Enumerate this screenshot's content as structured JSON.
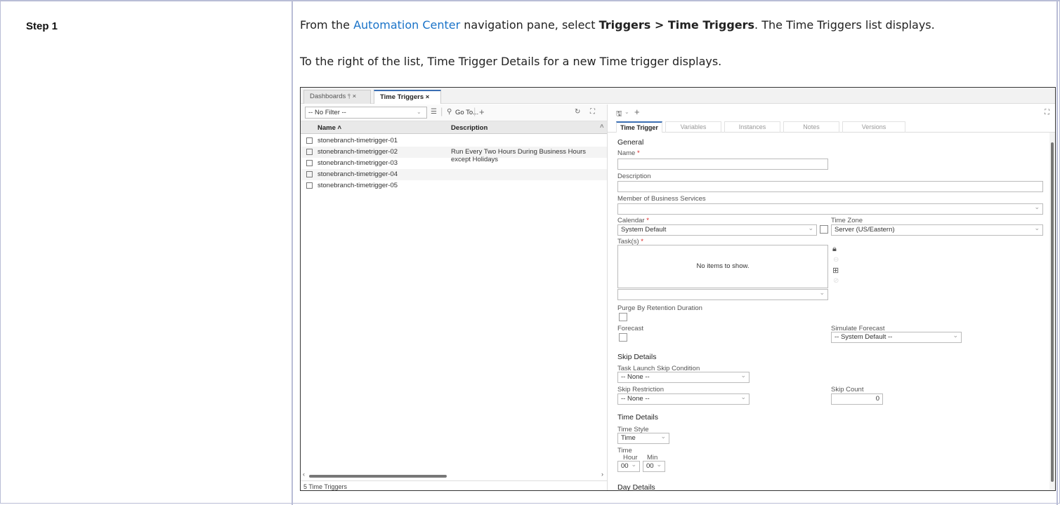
{
  "step": {
    "label": "Step 1"
  },
  "instructions": {
    "p1_pre": "From the ",
    "p1_link": "Automation Center",
    "p1_mid": " navigation pane, select ",
    "p1_bold": "Triggers > Time Triggers",
    "p1_post": ". The Time Triggers list displays.",
    "p2": "To the right of the list, Time Trigger Details for a new Time trigger displays."
  },
  "app": {
    "tabs": [
      {
        "label": "Dashboards ⫯ ×"
      },
      {
        "label": "Time Triggers ×"
      }
    ],
    "filter_value": "-- No Filter --",
    "goto_label": "Go To...",
    "list": {
      "col_name": "Name ˄",
      "col_desc": "Description",
      "rows": [
        {
          "name": "stonebranch-timetrigger-01",
          "desc": ""
        },
        {
          "name": "stonebranch-timetrigger-02",
          "desc": "Run Every Two Hours During Business Hours except Holidays"
        },
        {
          "name": "stonebranch-timetrigger-03",
          "desc": ""
        },
        {
          "name": "stonebranch-timetrigger-04",
          "desc": ""
        },
        {
          "name": "stonebranch-timetrigger-05",
          "desc": ""
        }
      ],
      "footer": "5 Time Triggers"
    },
    "detail_tabs": [
      "Time Trigger",
      "Variables",
      "Instances",
      "Notes",
      "Versions"
    ],
    "form": {
      "general": "General",
      "name_label": "Name",
      "description_label": "Description",
      "business_services_label": "Member of Business Services",
      "calendar_label": "Calendar",
      "calendar_value": "System Default",
      "timezone_label": "Time Zone",
      "timezone_value": "Server (US/Eastern)",
      "tasks_label": "Task(s)",
      "tasks_empty": "No items to show.",
      "purge_label": "Purge By Retention Duration",
      "forecast_label": "Forecast",
      "simulate_label": "Simulate Forecast",
      "simulate_value": "-- System Default --",
      "skip_details": "Skip Details",
      "skip_condition_label": "Task Launch Skip Condition",
      "skip_condition_value": "-- None --",
      "skip_restriction_label": "Skip Restriction",
      "skip_restriction_value": "-- None --",
      "skip_count_label": "Skip Count",
      "skip_count_value": "0",
      "time_details": "Time Details",
      "time_style_label": "Time Style",
      "time_style_value": "Time",
      "time_label": "Time",
      "hour_label": "Hour",
      "min_label": "Min",
      "hour_value": "00",
      "min_value": "00",
      "day_details": "Day Details",
      "required_mark": "*"
    }
  }
}
